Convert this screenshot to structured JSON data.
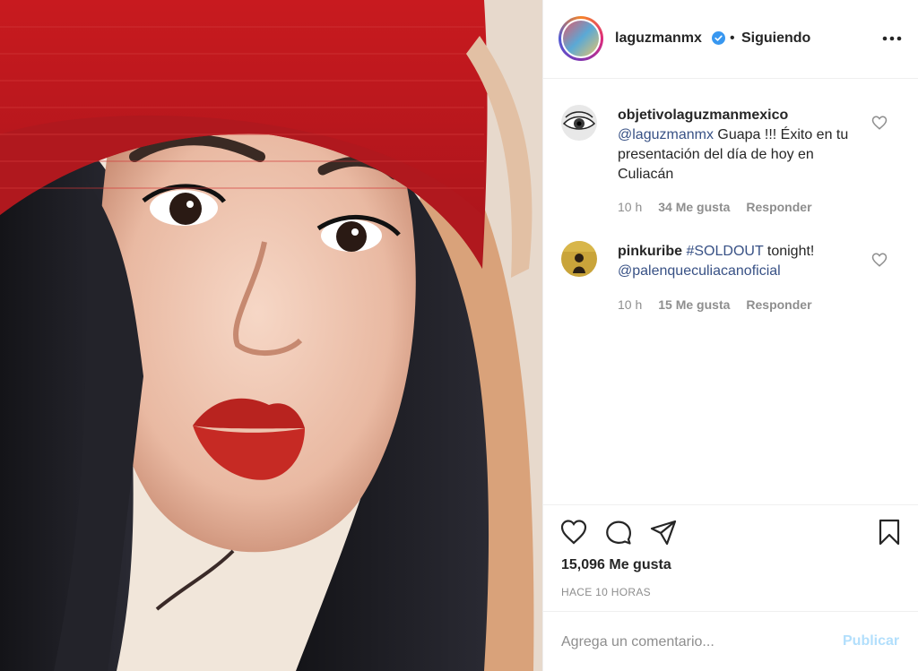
{
  "post": {
    "photo_alt": "",
    "header": {
      "username": "laguzmanmx",
      "separator": "•",
      "follow_status": "Siguiendo",
      "verified_color": "#3897f0"
    },
    "comments": [
      {
        "username": "objetivolaguzmanmexico",
        "mention": "@laguzmanmx",
        "text": " Guapa !!! Éxito en tu presentación del día de hoy en Culiacán",
        "time": "10 h",
        "likes": "34 Me gusta",
        "reply": "Responder"
      },
      {
        "username": "pinkuribe",
        "hashtag": "#SOLDOUT",
        "text": " tonight!",
        "mention": "@palenqueculiacanoficial",
        "time": "10 h",
        "likes": "15 Me gusta",
        "reply": "Responder"
      }
    ],
    "likes_count": "15,096 Me gusta",
    "time_ago": "HACE 10 HORAS",
    "comment_placeholder": "Agrega un comentario...",
    "publish_label": "Publicar",
    "icons": {
      "like": "heart-outline-icon",
      "comment": "speech-bubble-icon",
      "share": "paper-plane-icon",
      "save": "bookmark-icon",
      "more": "ellipsis-icon"
    },
    "colors": {
      "text": "#262626",
      "muted": "#8e8e8e",
      "link": "#385185",
      "publish_disabled": "#b2dffc"
    }
  }
}
